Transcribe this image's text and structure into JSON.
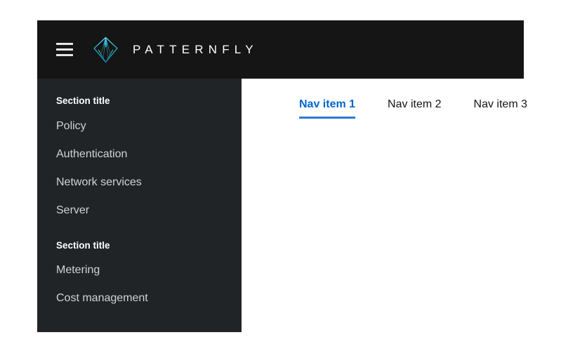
{
  "masthead": {
    "toggle_label": "Global navigation",
    "toggle_icon": "hamburger-menu-icon",
    "logo_icon": "patternfly-diamond-logo-icon",
    "brand_text": "PATTERNFLY",
    "background_color": "#151515"
  },
  "sidebar": {
    "background_color": "#212427",
    "item_color": "#d2d2d2",
    "sections": [
      {
        "title": "Section title",
        "items": [
          {
            "label": "Policy"
          },
          {
            "label": "Authentication"
          },
          {
            "label": "Network services"
          },
          {
            "label": "Server"
          }
        ]
      },
      {
        "title": "Section title",
        "items": [
          {
            "label": "Metering"
          },
          {
            "label": "Cost management"
          }
        ]
      }
    ]
  },
  "main": {
    "active_color": "#0066cc",
    "active_underline_color": "#2b7cd3",
    "inactive_color": "#151515",
    "tabs": [
      {
        "label": "Nav item 1",
        "active": true
      },
      {
        "label": "Nav item 2",
        "active": false
      },
      {
        "label": "Nav item 3",
        "active": false
      }
    ]
  }
}
